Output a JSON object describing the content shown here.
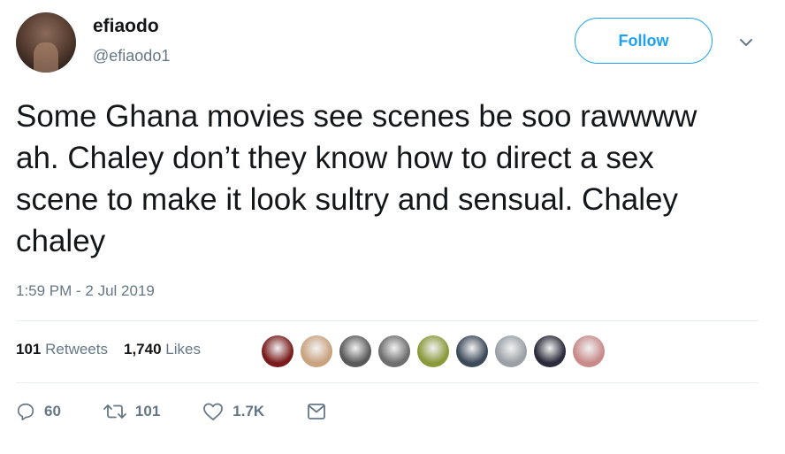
{
  "author": {
    "display_name": "efiaodo",
    "handle": "@efiaodo1",
    "follow_label": "Follow"
  },
  "tweet": {
    "text": "Some Ghana movies see scenes be soo rawwww ah. Chaley don’t they know how to direct a sex scene to make it look sultry and sensual. Chaley chaley",
    "timestamp": "1:59 PM - 2 Jul 2019"
  },
  "stats": {
    "retweets_count": "101",
    "retweets_label": "Retweets",
    "likes_count": "1,740",
    "likes_label": "Likes"
  },
  "liker_avatars": [
    {
      "color": "#7a1c1c"
    },
    {
      "color": "#c9a27e"
    },
    {
      "color": "#5a5a5a"
    },
    {
      "color": "#6e6e6e"
    },
    {
      "color": "#8a9a3a"
    },
    {
      "color": "#3d4a5a"
    },
    {
      "color": "#9aa0a6"
    },
    {
      "color": "#2b2b3b"
    },
    {
      "color": "#c98a8a"
    }
  ],
  "actions": {
    "reply_count": "60",
    "retweet_count": "101",
    "like_count": "1.7K"
  },
  "colors": {
    "accent": "#1da1f2",
    "secondary_text": "#657786",
    "divider": "#e6ecf0"
  },
  "icons": [
    "chevron-down-icon",
    "reply-icon",
    "retweet-icon",
    "heart-icon",
    "message-icon"
  ]
}
